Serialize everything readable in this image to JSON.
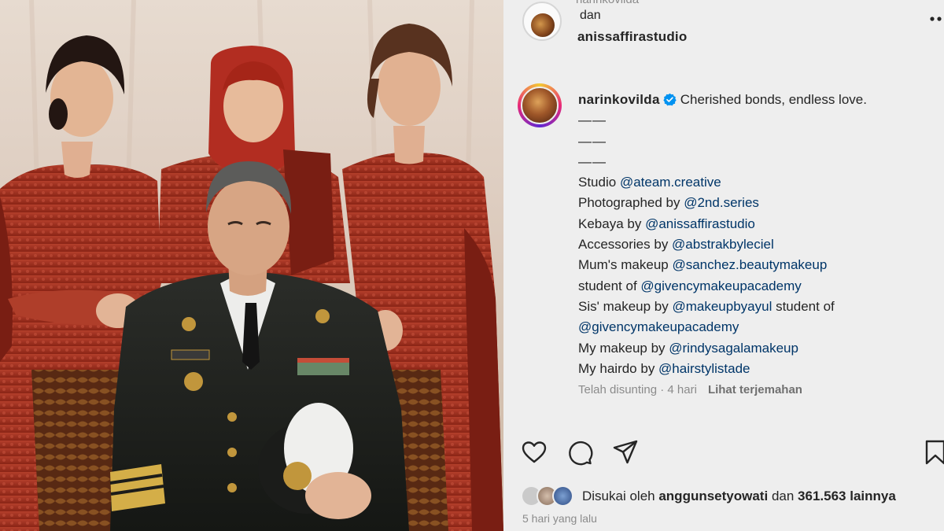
{
  "post": {
    "top_partial_text": "narinkovilda",
    "collab_joiner": "dan",
    "collab_account": "anissaffirastudio",
    "author": "narinkovilda",
    "caption_first": "Cherished bonds, endless love.",
    "dash_lines": [
      "——",
      "——",
      "——"
    ],
    "credit_lines": [
      {
        "pre": "Studio ",
        "mention": "@ateam.creative",
        "post": ""
      },
      {
        "pre": "Photographed by ",
        "mention": "@2nd.series",
        "post": ""
      },
      {
        "pre": "Kebaya by ",
        "mention": "@anissaffirastudio",
        "post": ""
      },
      {
        "pre": "Accessories by ",
        "mention": "@abstrakbyleciel",
        "post": ""
      },
      {
        "pre": "Mum's makeup ",
        "mention": "@sanchez.beautymakeup",
        "post": ""
      },
      {
        "pre": "student of ",
        "mention": "@givencymakeupacademy",
        "post": ""
      },
      {
        "pre": "Sis' makeup by ",
        "mention": "@makeupbyayul",
        "post": " student of"
      },
      {
        "pre": "",
        "mention": "@givencymakeupacademy",
        "post": ""
      },
      {
        "pre": "My makeup by ",
        "mention": "@rindysagalamakeup",
        "post": ""
      },
      {
        "pre": "My hairdo by ",
        "mention": "@hairstylistade",
        "post": ""
      }
    ],
    "edited_label": "Telah disunting · 4 hari",
    "translate_label": "Lihat terjemahan",
    "liked_prefix": "Disukai oleh",
    "liked_user": "anggunsetyowati",
    "liked_middle": "dan",
    "liked_count": "361.563",
    "liked_suffix": "lainnya",
    "posted_label": "5 hari yang lalu"
  },
  "icons": {
    "like": "heart-icon",
    "comment": "comment-icon",
    "share": "send-icon",
    "save": "bookmark-icon",
    "verified": "verified-badge-icon",
    "more": "more-icon"
  },
  "colors": {
    "mention": "#00376b",
    "verified": "#0095f6",
    "panel_bg": "#f3f3f3",
    "kebaya_red": "#a8311f"
  }
}
